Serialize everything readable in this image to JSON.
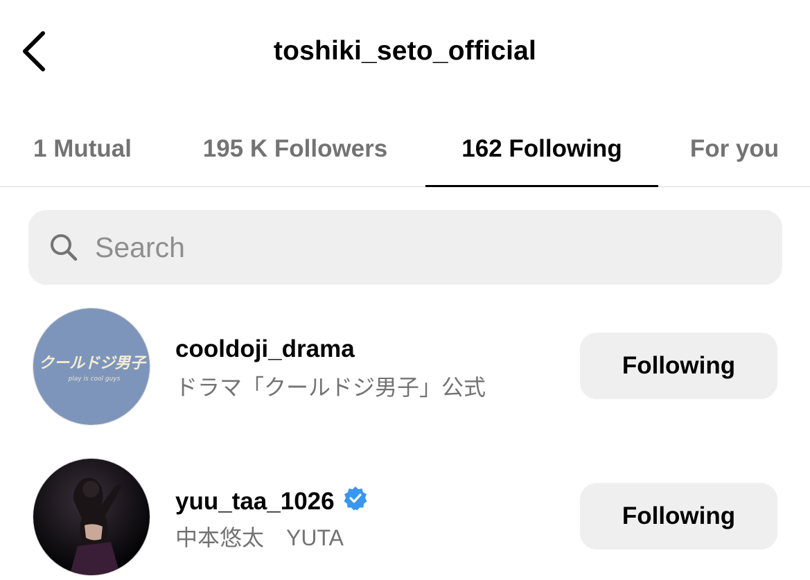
{
  "header": {
    "title": "toshiki_seto_official",
    "back_icon": "chevron-left-icon"
  },
  "tabs": [
    {
      "label": "1 Mutual",
      "active": false
    },
    {
      "label": "195 K Followers",
      "active": false
    },
    {
      "label": "162 Following",
      "active": true
    },
    {
      "label": "For you",
      "active": false
    }
  ],
  "search": {
    "placeholder": "Search",
    "value": "",
    "icon": "search-icon"
  },
  "users": [
    {
      "username": "cooldoji_drama",
      "full_name": "ドラマ「クールドジ男子」公式",
      "verified": false,
      "button_label": "Following",
      "avatar_text": "クールドジ男子",
      "avatar_subtext": "play is cool guys",
      "avatar_color": "#7e95bb"
    },
    {
      "username": "yuu_taa_1026",
      "full_name": "中本悠太　YUTA",
      "verified": true,
      "button_label": "Following",
      "avatar_color": "#0b0b0d"
    }
  ],
  "colors": {
    "text_primary": "#000000",
    "text_secondary": "#737373",
    "button_bg": "#efefef",
    "verified_badge": "#3897f0",
    "divider": "#dbdbdb"
  }
}
